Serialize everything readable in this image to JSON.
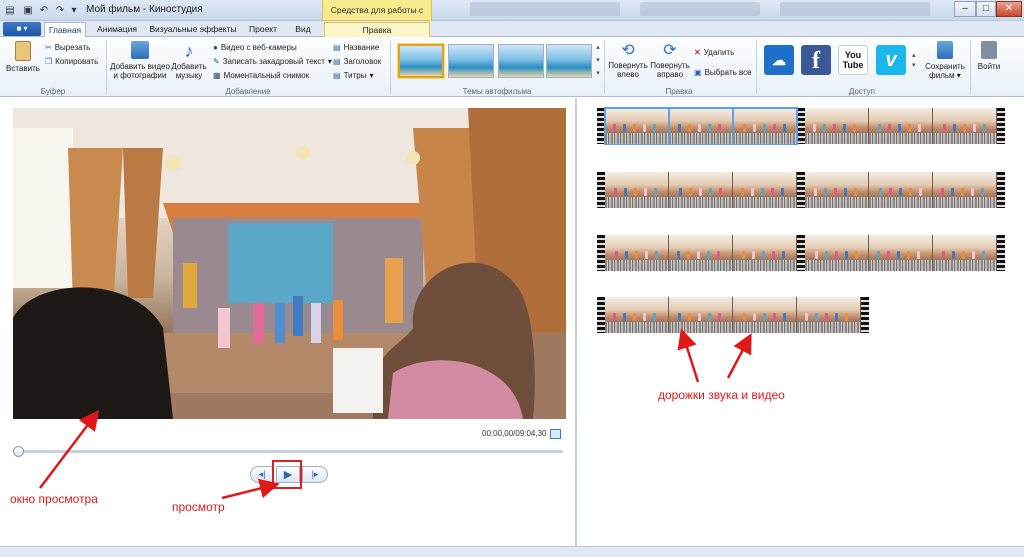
{
  "titlebar": {
    "title": "Мой фильм - Киностудия",
    "context_tab_header": "Средства для работы с видео",
    "minimize": "–",
    "maximize": "□",
    "close": "✕"
  },
  "tabs": {
    "file": "■ ▾",
    "items": [
      "Главная",
      "Анимация",
      "Визуальные эффекты",
      "Проект",
      "Вид"
    ],
    "edit": "Правка"
  },
  "ribbon": {
    "clipboard": {
      "paste": "Вставить",
      "cut": "Вырезать",
      "copy": "Копировать",
      "group": "Буфер"
    },
    "add": {
      "add_video": "Добавить видео и фотографии",
      "add_music": "Добавить музыку",
      "webcam": "Видео с веб-камеры",
      "voiceover": "Записать закадровый текст",
      "snapshot": "Моментальный снимок",
      "title": "Название",
      "caption": "Заголовок",
      "credits": "Титры",
      "group": "Добавление"
    },
    "themes": {
      "group": "Темы автофильма"
    },
    "editing": {
      "rotate_left": "Повернуть влево",
      "rotate_right": "Повернуть вправо",
      "delete": "Удалить",
      "select_all": "Выбрать все",
      "group": "Правка"
    },
    "share": {
      "group": "Доступ",
      "save_movie": "Сохранить фильм",
      "exit": "Войти",
      "services": [
        "onedrive-icon",
        "facebook-icon",
        "youtube-icon",
        "vimeo-icon"
      ],
      "youtube_text": "You Tube",
      "facebook_text": "f",
      "vimeo_text": "v"
    }
  },
  "preview": {
    "time": "00:00,00/09:04,30",
    "progress": 0.0
  },
  "storyboard": {
    "rows": [
      {
        "frames": 6,
        "selected_frames": 3
      },
      {
        "frames": 6,
        "selected_frames": 0
      },
      {
        "frames": 6,
        "selected_frames": 0
      },
      {
        "frames": 4,
        "selected_frames": 0
      }
    ]
  },
  "annotations": {
    "preview_window": "окно просмотра",
    "play": "просмотр",
    "tracks": "дорожки звука и видео"
  },
  "colors": {
    "annotation": "#e01818",
    "accent": "#1f56a8",
    "selection": "#5aa2e6"
  }
}
